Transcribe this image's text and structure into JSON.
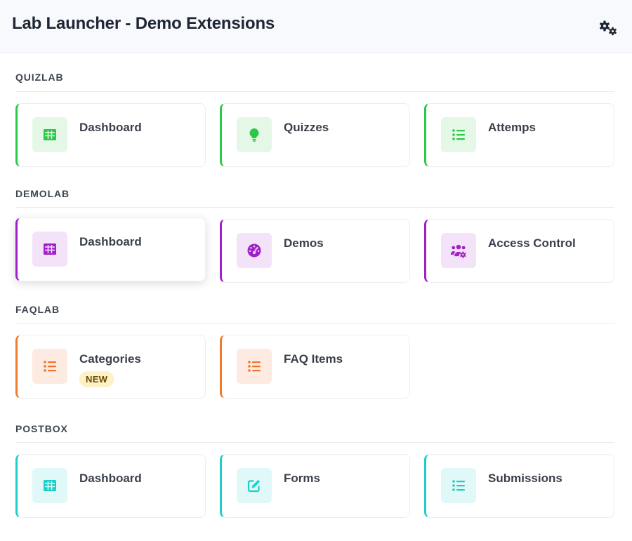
{
  "header": {
    "title": "Lab Launcher - Demo Extensions",
    "settings_icon": "gears-icon"
  },
  "colors": {
    "quizlab": "#2bc94a",
    "demolab": "#a020c8",
    "faqlab": "#f27b2b",
    "postbox": "#1ccfc9",
    "badge_bg": "#fdf1c6"
  },
  "sections": [
    {
      "title": "QUIZLAB",
      "items": [
        {
          "label": "Dashboard",
          "icon": "table-icon"
        },
        {
          "label": "Quizzes",
          "icon": "lightbulb-icon"
        },
        {
          "label": "Attemps",
          "icon": "list-icon"
        }
      ]
    },
    {
      "title": "DEMOLAB",
      "items": [
        {
          "label": "Dashboard",
          "icon": "table-icon"
        },
        {
          "label": "Demos",
          "icon": "speedometer-icon"
        },
        {
          "label": "Access Control",
          "icon": "users-cog-icon"
        }
      ]
    },
    {
      "title": "FAQLAB",
      "items": [
        {
          "label": "Categories",
          "icon": "list-icon",
          "badge": "NEW"
        },
        {
          "label": "FAQ Items",
          "icon": "list-icon"
        }
      ]
    },
    {
      "title": "POSTBOX",
      "items": [
        {
          "label": "Dashboard",
          "icon": "table-icon"
        },
        {
          "label": "Forms",
          "icon": "edit-icon"
        },
        {
          "label": "Submissions",
          "icon": "list-icon"
        }
      ]
    }
  ]
}
